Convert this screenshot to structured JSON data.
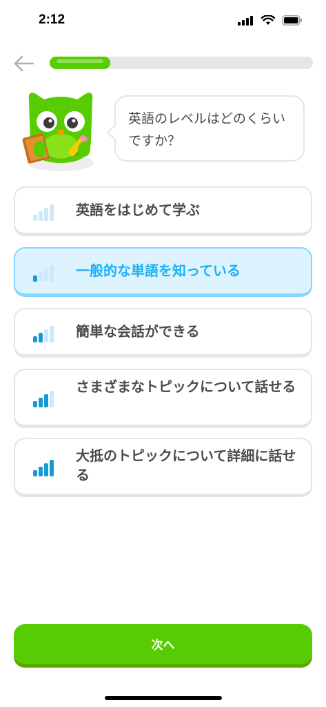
{
  "status_bar": {
    "time": "2:12"
  },
  "header": {
    "progress_percent": 23
  },
  "question": {
    "text": "英語のレベルはどのくらいですか？"
  },
  "options": [
    {
      "label": "英語をはじめて学ぶ",
      "level": 0,
      "selected": false
    },
    {
      "label": "一般的な単語を知っている",
      "level": 1,
      "selected": true
    },
    {
      "label": "簡単な会話ができる",
      "level": 2,
      "selected": false
    },
    {
      "label": "さまざまなトピックについて話せる",
      "level": 3,
      "selected": false
    },
    {
      "label": "大抵のトピックについて詳細に話せる",
      "level": 4,
      "selected": false
    }
  ],
  "footer": {
    "next_label": "次へ"
  },
  "colors": {
    "brand_green": "#58cc02",
    "selected_blue": "#1cb0f6",
    "bar_active": "#1899d6",
    "bar_inactive": "#cde9f8"
  }
}
